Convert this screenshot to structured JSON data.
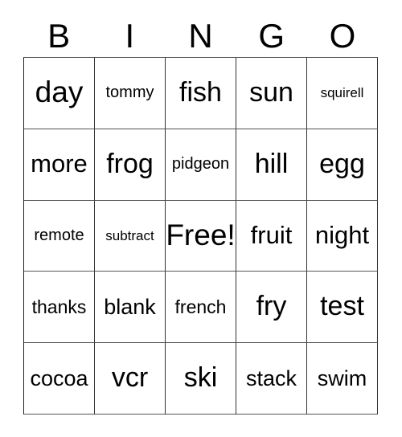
{
  "card": {
    "header_letters": [
      "B",
      "I",
      "N",
      "G",
      "O"
    ],
    "rows": [
      [
        {
          "text": "day",
          "size": "fs-xxl"
        },
        {
          "text": "tommy",
          "size": "fs-xs"
        },
        {
          "text": "fish",
          "size": "fs-xl"
        },
        {
          "text": "sun",
          "size": "fs-xl"
        },
        {
          "text": "squirell",
          "size": "fs-xxs"
        }
      ],
      [
        {
          "text": "more",
          "size": "fs-l"
        },
        {
          "text": "frog",
          "size": "fs-xl"
        },
        {
          "text": "pidgeon",
          "size": "fs-xs"
        },
        {
          "text": "hill",
          "size": "fs-xl"
        },
        {
          "text": "egg",
          "size": "fs-xl"
        }
      ],
      [
        {
          "text": "remote",
          "size": "fs-xs"
        },
        {
          "text": "subtract",
          "size": "fs-xxs"
        },
        {
          "text": "Free!",
          "size": "fs-xxl"
        },
        {
          "text": "fruit",
          "size": "fs-l"
        },
        {
          "text": "night",
          "size": "fs-l"
        }
      ],
      [
        {
          "text": "thanks",
          "size": "fs-s"
        },
        {
          "text": "blank",
          "size": "fs-m"
        },
        {
          "text": "french",
          "size": "fs-s"
        },
        {
          "text": "fry",
          "size": "fs-xl"
        },
        {
          "text": "test",
          "size": "fs-xl"
        }
      ],
      [
        {
          "text": "cocoa",
          "size": "fs-m"
        },
        {
          "text": "vcr",
          "size": "fs-xl"
        },
        {
          "text": "ski",
          "size": "fs-xl"
        },
        {
          "text": "stack",
          "size": "fs-m"
        },
        {
          "text": "swim",
          "size": "fs-m"
        }
      ]
    ],
    "free_space": {
      "row": 2,
      "column": 2,
      "label": "Free!"
    },
    "colors": {
      "background": "#ffffff",
      "text": "#000000",
      "grid_line": "#333333"
    }
  }
}
